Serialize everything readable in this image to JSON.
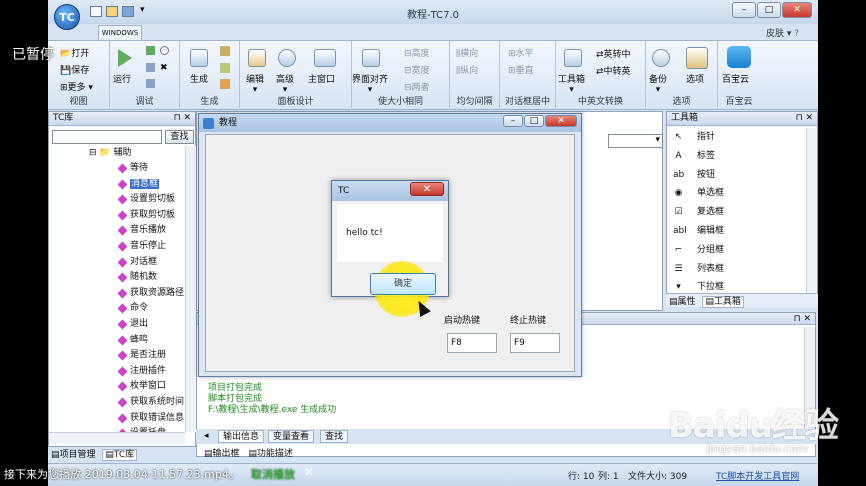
{
  "overlay": {
    "paused": "已暂停",
    "next_play": "接下来为您播放:2019.03.04-11.57.23.mp4。",
    "cancel": "取消播放",
    "close_glyph": "✕",
    "watermark_brand": "Baidu经验",
    "watermark_url": "jingyan.baidu.com"
  },
  "window": {
    "title": "教程-TC7.0",
    "orb": "TC",
    "skin": "皮肤",
    "minimize": "–",
    "restore": "□",
    "close": "✕"
  },
  "ribbon": {
    "tab": "WINDOWS",
    "groups": {
      "view": {
        "label": "视图",
        "open": "打开",
        "save": "保存",
        "more": "更多"
      },
      "debug": {
        "label": "调试",
        "run": "运行"
      },
      "build": {
        "label": "生成",
        "build": "生成"
      },
      "panel": {
        "label": "面板设计",
        "edit": "编辑",
        "advanced": "高级",
        "main_window": "主窗口"
      },
      "align": {
        "label": "使大小相同",
        "interface_align": "界面对齐",
        "height": "高度",
        "width": "宽度",
        "both": "两者"
      },
      "spacing": {
        "label": "均匀间隔",
        "horizontal": "横向",
        "vertical": "纵向"
      },
      "center": {
        "label": "对话框居中",
        "horizontal": "水平",
        "vertical": "垂直"
      },
      "cnconv": {
        "label": "中英文转换",
        "toolbox": "工具箱",
        "en_to_cn": "英转中",
        "cn_to_en": "中转英"
      },
      "options": {
        "label": "选项",
        "backup": "备份",
        "options": "选项"
      },
      "baidu": {
        "label": "百宝云",
        "baidu": "百宝云"
      }
    }
  },
  "tc_pane": {
    "title": "TC库",
    "search_button": "查找",
    "root": "辅助",
    "items": [
      "等待",
      "消息框",
      "设置剪切板",
      "获取剪切板",
      "音乐播放",
      "音乐停止",
      "对话框",
      "随机数",
      "获取资源路径",
      "命令",
      "退出",
      "蜂鸣",
      "是否注册",
      "注册插件",
      "枚举窗口",
      "获取系统时间",
      "获取错误信息",
      "设置托盘"
    ],
    "selected_index": 1,
    "tabs": [
      "项目管理",
      "TC库"
    ]
  },
  "toolbox": {
    "title": "工具箱",
    "items": [
      {
        "icon": "pointer-icon",
        "glyph": "↖",
        "label": "指针"
      },
      {
        "icon": "label-icon",
        "glyph": "A",
        "label": "标签"
      },
      {
        "icon": "button-icon",
        "glyph": "ab",
        "label": "按钮"
      },
      {
        "icon": "radio-icon",
        "glyph": "◉",
        "label": "单选框"
      },
      {
        "icon": "checkbox-icon",
        "glyph": "☑",
        "label": "复选框"
      },
      {
        "icon": "editbox-icon",
        "glyph": "abl",
        "label": "编辑框"
      },
      {
        "icon": "groupbox-icon",
        "glyph": "⌐",
        "label": "分组框"
      },
      {
        "icon": "listbox-icon",
        "glyph": "☰",
        "label": "列表框"
      },
      {
        "icon": "dropdown-icon",
        "glyph": "▾",
        "label": "下拉框"
      }
    ],
    "tabs": [
      "属性",
      "工具箱"
    ]
  },
  "output": {
    "lines": [
      "项目打包完成",
      "脚本打包完成",
      "F:\\教程\\生成\\教程.exe 生成成功"
    ],
    "tabs": [
      "输出信息",
      "变量查看",
      "查找"
    ],
    "bottom_tabs": [
      "输出框",
      "功能描述"
    ]
  },
  "status": {
    "line": "行: 10",
    "col": "列: 1",
    "file_size": "文件大小: 309",
    "link": "TC脚本开发工具官网"
  },
  "tutorial_window": {
    "title": "教程",
    "start_hotkey_label": "启动热键",
    "stop_hotkey_label": "终止热键",
    "start_hotkey": "F8",
    "stop_hotkey": "F9"
  },
  "msgbox": {
    "title": "TC",
    "text": "hello tc!",
    "ok": "确定",
    "close": "✕"
  }
}
